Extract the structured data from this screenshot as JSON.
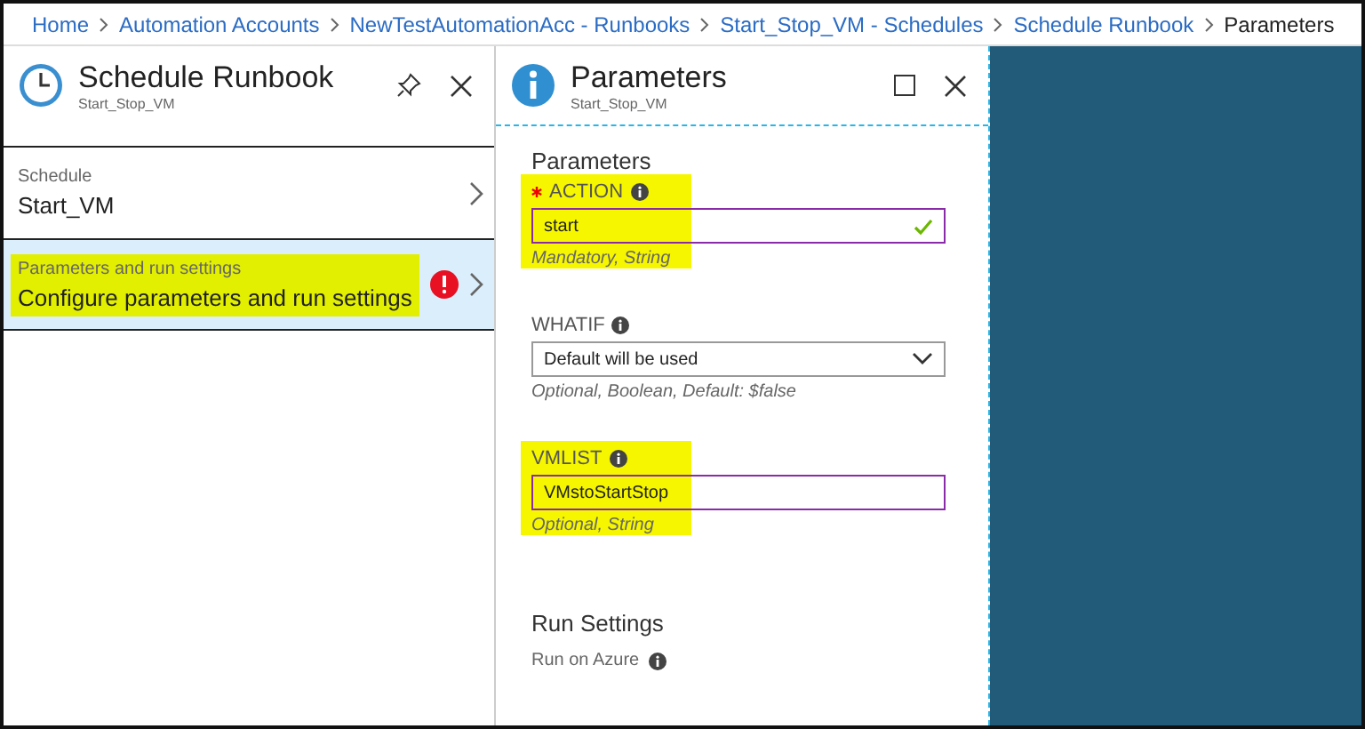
{
  "breadcrumb": [
    {
      "label": "Home",
      "current": false
    },
    {
      "label": "Automation Accounts",
      "current": false
    },
    {
      "label": "NewTestAutomationAcc - Runbooks",
      "current": false
    },
    {
      "label": "Start_Stop_VM - Schedules",
      "current": false
    },
    {
      "label": "Schedule Runbook",
      "current": false
    },
    {
      "label": "Parameters",
      "current": true
    }
  ],
  "left_blade": {
    "title": "Schedule Runbook",
    "subtitle": "Start_Stop_VM",
    "items": [
      {
        "label": "Schedule",
        "value": "Start_VM",
        "selected": false,
        "error": false,
        "highlighted": false
      },
      {
        "label": "Parameters and run settings",
        "value": "Configure parameters and run settings",
        "selected": true,
        "error": true,
        "highlighted": true
      }
    ]
  },
  "right_blade": {
    "title": "Parameters",
    "subtitle": "Start_Stop_VM",
    "section": "Parameters",
    "fields": [
      {
        "kind": "text",
        "label": "ACTION",
        "required": true,
        "value": "start",
        "valid": true,
        "hint": "Mandatory, String",
        "highlighted": true
      },
      {
        "kind": "select",
        "label": "WHATIF",
        "required": false,
        "value": "Default will be used",
        "valid": false,
        "hint": "Optional, Boolean, Default: $false",
        "highlighted": false
      },
      {
        "kind": "text",
        "label": "VMLIST",
        "required": false,
        "value": "VMstoStartStop",
        "valid": false,
        "hint": "Optional, String",
        "highlighted": true
      }
    ],
    "run_settings": {
      "title": "Run Settings",
      "label": "Run on Azure"
    }
  }
}
